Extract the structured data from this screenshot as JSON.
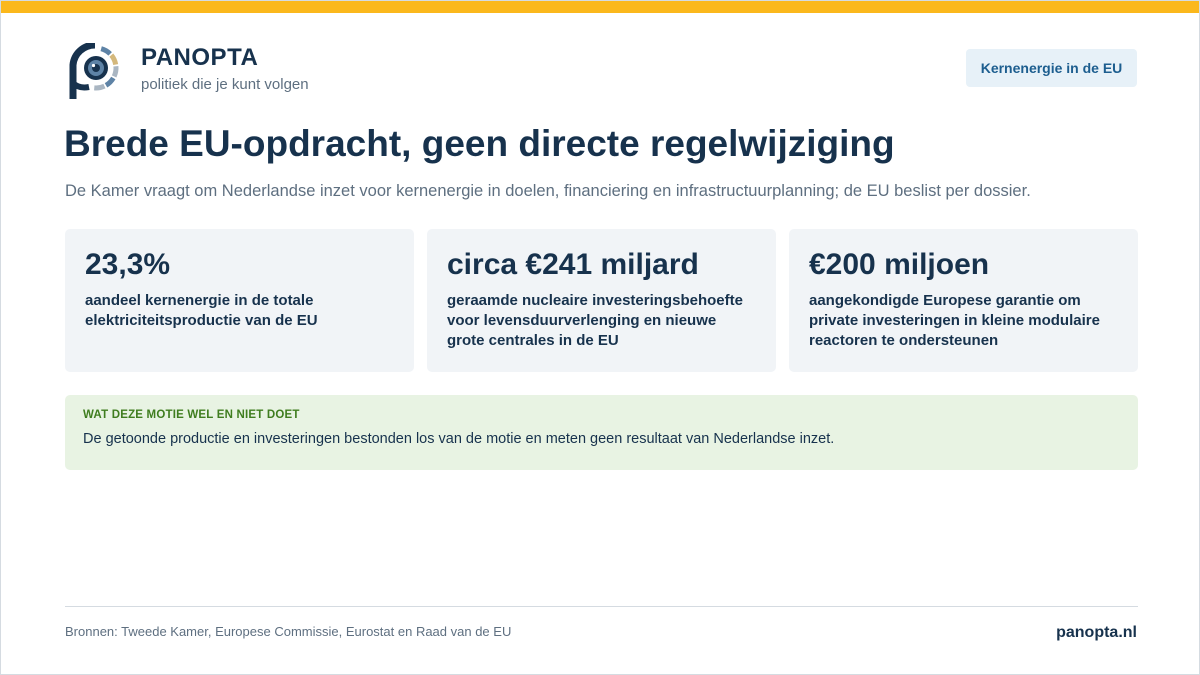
{
  "colors": {
    "accent_bar": "#fbb81c",
    "brand_navy": "#17324d",
    "muted_text": "#5e6f80",
    "badge_bg": "#e7f1f8",
    "badge_text": "#1d5e8f",
    "notice_bg": "#e8f3e3",
    "notice_title": "#3f7d1f",
    "logo_blue": "#5e83a6",
    "logo_gold": "#d4b87c",
    "logo_grey": "#aab6c2"
  },
  "brand": {
    "name": "PANOPTA",
    "tagline": "politiek die je kunt volgen",
    "logo_icon": "panopta-eye-logo-icon"
  },
  "topic_badge": "Kernenergie in de EU",
  "headline": "Brede EU-opdracht, geen directe regelwijziging",
  "subheadline": "De Kamer vraagt om Nederlandse inzet voor kernenergie in doelen, financiering en infrastructuurplanning; de EU beslist per dossier.",
  "stats": [
    {
      "value": "23,3%",
      "label": "aandeel kernenergie in de totale elektriciteitsproductie van de EU"
    },
    {
      "value": "circa €241 miljard",
      "label": "geraamde nucleaire investeringsbehoefte voor levensduurverlenging en nieuwe grote centrales in de EU"
    },
    {
      "value": "€200 miljoen",
      "label": "aangekondigde Europese garantie om private investeringen in kleine modulaire reactoren te ondersteunen"
    }
  ],
  "notice": {
    "title": "WAT DEZE MOTIE WEL EN NIET DOET",
    "body": "De getoonde productie en investeringen bestonden los van de motie en meten geen resultaat van Nederlandse inzet."
  },
  "footer": {
    "sources": "Bronnen: Tweede Kamer, Europese Commissie, Eurostat en Raad van de EU",
    "site": "panopta.nl"
  }
}
